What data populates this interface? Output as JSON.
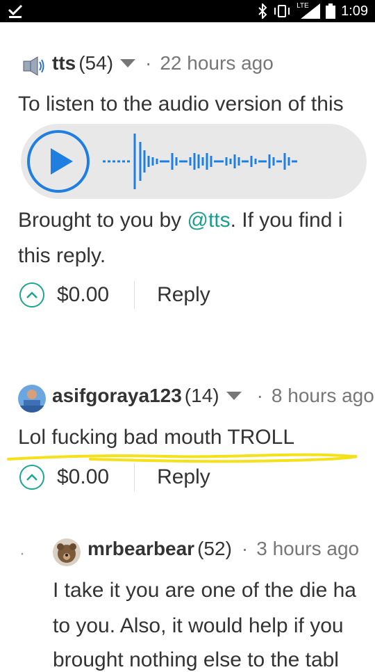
{
  "status_bar": {
    "time": "1:09",
    "network": "LTE"
  },
  "comment1": {
    "author": "tts",
    "reputation": "(54)",
    "time": "22 hours ago",
    "line1": "To listen to the audio version of this",
    "line2_pre": "Brought to you by ",
    "line2_link": "@tts",
    "line2_post": ". If you find i",
    "line3": "this reply.",
    "payout": "$0.00",
    "reply": "Reply"
  },
  "comment2": {
    "author": "asifgoraya123",
    "reputation": "(14)",
    "time": "8 hours ago",
    "text": "Lol fucking bad mouth TROLL",
    "payout": "$0.00",
    "reply": "Reply"
  },
  "comment3": {
    "author": "mrbearbear",
    "reputation": "(52)",
    "time": "3 hours ago",
    "line1": "I take it you are one of the die ha",
    "line2": "to you. Also, it would help if you",
    "line3": "brought nothing else to the tabl"
  },
  "colors": {
    "accent": "#1aa68f",
    "link": "#1a9e8f",
    "highlight": "#f5e11a",
    "audio_blue": "#1f7fe0"
  }
}
